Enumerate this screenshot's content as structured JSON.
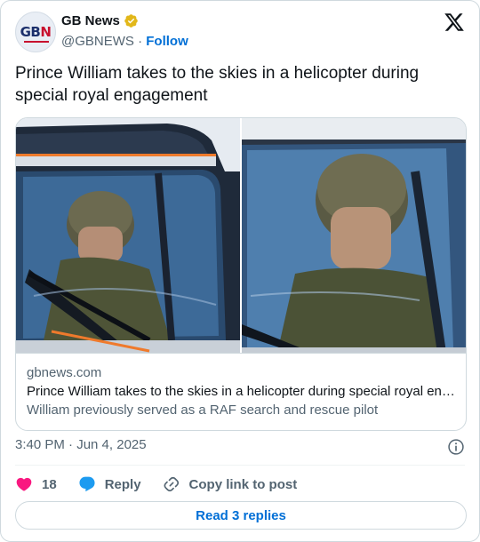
{
  "account": {
    "display_name": "GB News",
    "handle": "@GBNEWS",
    "separator": "·",
    "follow_label": "Follow",
    "avatar_text_left": "GB",
    "avatar_text_right": "N"
  },
  "tweet": {
    "text": "Prince William takes to the skies in a helicopter during special royal engagement"
  },
  "link_card": {
    "domain": "gbnews.com",
    "title": "Prince William takes to the skies in a helicopter during special royal en…",
    "description": "William previously served as a RAF search and rescue pilot"
  },
  "meta": {
    "timestamp": "3:40 PM · Jun 4, 2025"
  },
  "actions": {
    "like_count": "18",
    "reply_label": "Reply",
    "copy_link_label": "Copy link to post"
  },
  "replies_button": {
    "label": "Read 3 replies"
  },
  "colors": {
    "brand_blue": "#006fd6",
    "like_red": "#f91880",
    "reply_blue": "#1d9bf0",
    "verified_gold": "#e2b719",
    "secondary_text": "#536471"
  },
  "icons": [
    "verified-badge-icon",
    "x-logo-icon",
    "info-icon",
    "heart-icon",
    "speech-bubble-icon",
    "link-icon"
  ]
}
